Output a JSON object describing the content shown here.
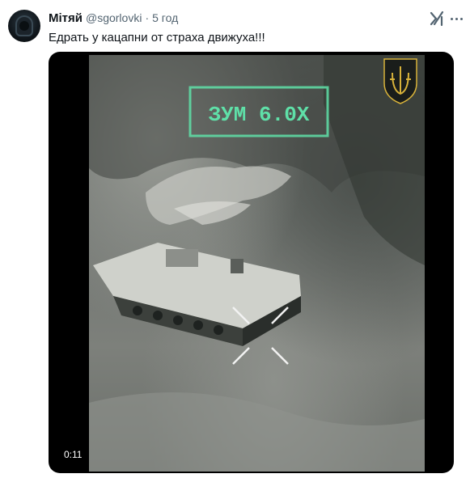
{
  "tweet": {
    "author_name": "Мітяй",
    "handle": "@sgorlovki",
    "separator": "·",
    "time": "5 год",
    "text": "Едрать у кацапни от страха движуха!!!"
  },
  "icons": {
    "grok": "grok-icon",
    "more": "more-options-icon",
    "emblem": "trident-shield-emblem"
  },
  "video": {
    "overlay_text": "ЗУМ 6.0Х",
    "duration": "0:11"
  },
  "colors": {
    "overlay_green": "#5fe0a8",
    "text_primary": "#0f1419",
    "text_secondary": "#536471",
    "emblem_gold": "#d8b23a"
  }
}
